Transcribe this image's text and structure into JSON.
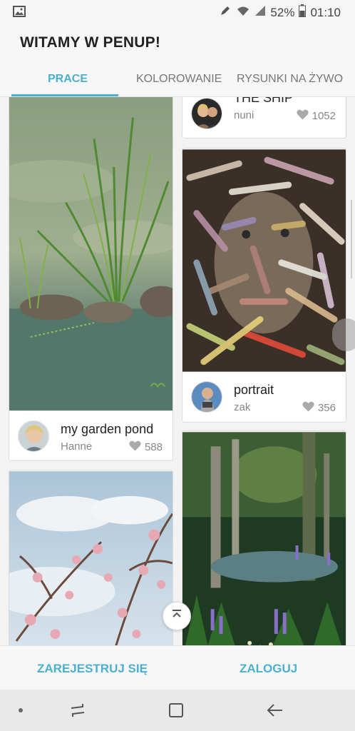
{
  "status_bar": {
    "battery": "52%",
    "time": "01:10"
  },
  "app": {
    "title": "WITAMY W PENUP!"
  },
  "tabs": [
    {
      "label": "PRACE",
      "active": true
    },
    {
      "label": "KOLOROWANIE",
      "active": false
    },
    {
      "label": "RYSUNKI NA ŻYWO",
      "active": false
    }
  ],
  "posts": [
    {
      "title": "my garden pond",
      "user": "Hanne",
      "likes": "588"
    },
    {
      "title": "THE SHIP",
      "user": "nuni",
      "likes": "1052"
    },
    {
      "title": "portrait",
      "user": "zak",
      "likes": "356"
    }
  ],
  "actions": {
    "register": "ZAREJESTRUJ SIĘ",
    "login": "ZALOGUJ"
  },
  "colors": {
    "accent": "#4bb0cc"
  }
}
